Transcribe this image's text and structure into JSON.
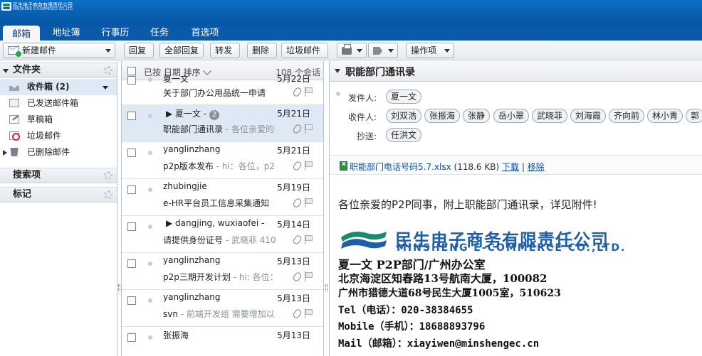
{
  "app": {
    "logo_text": "民生电子商务有限责任公司",
    "logo_sub": "MINSHENG E-COMMERCE CO.,LTD."
  },
  "tabs": [
    {
      "label": "邮箱",
      "active": true
    },
    {
      "label": "地址簿",
      "active": false
    },
    {
      "label": "行事历",
      "active": false
    },
    {
      "label": "任务",
      "active": false
    },
    {
      "label": "首选项",
      "active": false
    }
  ],
  "toolbar": {
    "new_mail": "新建邮件",
    "reply": "回复",
    "reply_all": "全部回复",
    "forward": "转发",
    "delete": "删除",
    "junk": "垃圾邮件",
    "actions": "操作项"
  },
  "sidebar": {
    "folders_header": "文件夹",
    "folders": [
      {
        "label": "收件箱 (2)",
        "icon": "inbox-icon",
        "selected": true
      },
      {
        "label": "已发送邮件箱",
        "icon": "sent-icon",
        "selected": false
      },
      {
        "label": "草稿箱",
        "icon": "drafts-icon",
        "selected": false
      },
      {
        "label": "垃圾邮件",
        "icon": "junk-icon",
        "selected": false
      },
      {
        "label": "已删除邮件",
        "icon": "trash-icon",
        "selected": false
      }
    ],
    "search_header": "搜索项",
    "tags_header": "标记"
  },
  "list": {
    "sort_label": "已按 日期 排序",
    "count": "108 个会话",
    "rows": [
      {
        "sender": "夏一文",
        "date": "5月22日",
        "subject": "关于部门办公用品统一申请",
        "preview": "",
        "selected": false,
        "thread": false,
        "badge": ""
      },
      {
        "sender": "夏一文 -",
        "date": "5月21日",
        "subject": "职能部门通讯录",
        "preview": " - 各位亲爱的",
        "selected": true,
        "thread": true,
        "badge": "2"
      },
      {
        "sender": "yanglinzhang",
        "date": "5月21日",
        "subject": "p2p版本发布",
        "preview": " - hi：各位，p2",
        "selected": false,
        "thread": false,
        "badge": ""
      },
      {
        "sender": "zhubingjie",
        "date": "5月19日",
        "subject": "e-HR平台员工信息采集通知",
        "preview": "",
        "selected": false,
        "thread": false,
        "badge": ""
      },
      {
        "sender": "dangjing, wuxiaofei -",
        "date": "5月14日",
        "subject": "请提供身份证号",
        "preview": " - 武晓菲 410:",
        "selected": false,
        "thread": true,
        "badge": ""
      },
      {
        "sender": "yanglinzhang",
        "date": "5月13日",
        "subject": "p2p三期开发计划",
        "preview": " - hi: 各位：",
        "selected": false,
        "thread": false,
        "badge": ""
      },
      {
        "sender": "yanglinzhang",
        "date": "5月13日",
        "subject": "svn",
        "preview": " - 前端开发组 需要增加以",
        "selected": false,
        "thread": false,
        "badge": ""
      },
      {
        "sender": "张振海",
        "date": "5月13日",
        "subject": "",
        "preview": "",
        "selected": false,
        "thread": false,
        "badge": ""
      }
    ]
  },
  "message": {
    "subject": "职能部门通讯录",
    "from_label": "发件人:",
    "from": "夏一文",
    "to_label": "收件人:",
    "to": [
      "刘双浩",
      "张振海",
      "张静",
      "岳小翠",
      "武晓菲",
      "刘海霞",
      "齐向前",
      "林小青",
      "郭"
    ],
    "cc_label": "抄送:",
    "cc": [
      "任洪文"
    ],
    "attachment": {
      "name": "职能部门电话号码5.7.xlsx",
      "size": "(118.6 KB)",
      "download": "下载",
      "separator": "|",
      "move": "移除"
    },
    "greeting": "各位亲爱的P2P同事，附上职能部门通讯录，详见附件!",
    "company_cn": "民生电子商务有限责任公司",
    "company_en": "MINSHENG E-COMMERCE CO.,LTD.",
    "sig_name": "夏一文   P2P部门/广州办公室",
    "sig_addr1": "北京海淀区知春路13号航南大厦，100082",
    "sig_addr2": "广州市猎德大道68号民生大厦1005室，510623",
    "sig_tel": "Tel（电话）：020-38384655",
    "sig_mobile": "Mobile（手机）：18688893796",
    "sig_mail": "Mail（邮箱）：xiayiwen@minshengec.cn"
  },
  "colors": {
    "brand_blue": "#0a5aa9",
    "logo_green": "#1b8a6b",
    "selection": "#dfe9f5"
  }
}
